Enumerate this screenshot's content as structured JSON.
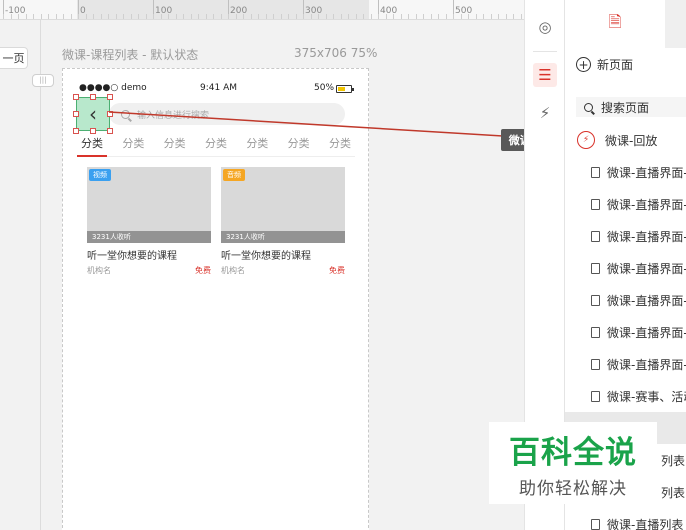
{
  "ruler": {
    "labels": [
      "-100",
      "0",
      "100",
      "200",
      "300",
      "400",
      "500"
    ]
  },
  "canvas": {
    "prev_page_label": "一页",
    "frame_title": "微课-课程列表 - 默认状态",
    "frame_size": "375x706 75%",
    "link_label": "微课-回放"
  },
  "phone": {
    "carrier": "●●●●○ demo",
    "time": "9:41 AM",
    "battery": "50%",
    "search_placeholder": "输入信息进行搜索",
    "back_icon": "chevron-left-icon",
    "tabs": [
      "分类",
      "分类",
      "分类",
      "分类",
      "分类",
      "分类",
      "分类"
    ],
    "cards": [
      {
        "badge": "视频",
        "badge_color": "#3aa0f0",
        "listen": "3231人收听",
        "title": "听一堂你想要的课程",
        "org": "机构名",
        "price": "免费"
      },
      {
        "badge": "音频",
        "badge_color": "#f5a623",
        "listen": "3231人收听",
        "title": "听一堂你想要的课程",
        "org": "机构名",
        "price": "免费"
      }
    ]
  },
  "tools": [
    {
      "icon": "target-icon"
    },
    {
      "icon": "sliders-icon",
      "active": true
    },
    {
      "icon": "bolt-icon"
    }
  ],
  "pages_panel": {
    "new_page_label": "新页面",
    "search_label": "搜索页面",
    "items": [
      {
        "label": "微课-回放",
        "active": true
      },
      {
        "label": "微课-直播界面-"
      },
      {
        "label": "微课-直播界面-"
      },
      {
        "label": "微课-直播界面-"
      },
      {
        "label": "微课-直播界面-"
      },
      {
        "label": "微课-直播界面-"
      },
      {
        "label": "微课-直播界面-"
      },
      {
        "label": "微课-直播界面-"
      },
      {
        "label": "微课-赛事、活动"
      },
      {
        "label": "列表",
        "highlight": true
      },
      {
        "label": "列表"
      },
      {
        "label": "列表"
      },
      {
        "label": "微课-直播列表"
      }
    ]
  },
  "watermark": {
    "title": "百科全说",
    "subtitle": "助你轻松解决"
  },
  "colors": {
    "accent": "#d9322a",
    "selection_fill": "#b8e8cc",
    "link_line": "#c0392b"
  }
}
